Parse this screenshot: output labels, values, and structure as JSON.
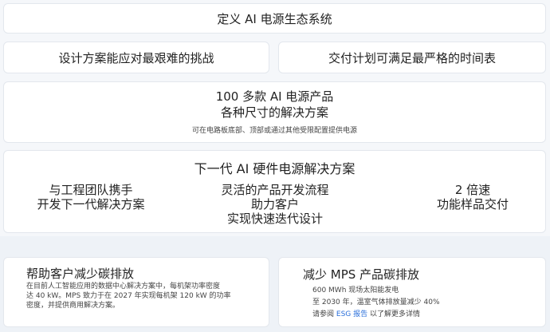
{
  "header": {
    "title": "定义 AI 电源生态系统"
  },
  "row2": {
    "left": "设计方案能应对最艰难的挑战",
    "right": "交付计划可满足最严格的时间表"
  },
  "products": {
    "line1": "100 多款 AI 电源产品",
    "line2": "各种尺寸的解决方案",
    "note": "可在电路板底部、顶部或通过其他受限配置提供电源"
  },
  "nextgen": {
    "title": "下一代 AI 硬件电源解决方案",
    "col1": [
      "与工程团队携手",
      "开发下一代解决方案"
    ],
    "col2": [
      "灵活的产品开发流程",
      "助力客户",
      "实现快速迭代设计"
    ],
    "col3": [
      "2 倍速",
      "功能样品交付"
    ]
  },
  "carbon_customer": {
    "title": "帮助客户减少碳排放",
    "body1": "在目前人工智能应用的数据中心解决方案中，每机架功率密度",
    "body2": "达 40 kW。MPS 致力于在 2027 年实现每机架 120 kW 的功率",
    "body3": "密度，并提供商用解决方案。"
  },
  "carbon_mps": {
    "title": "减少 MPS 产品碳排放",
    "line1": "600 MWh 现场太阳能发电",
    "line2": "至 2030 年，温室气体排放量减少 40%",
    "line3_pre": "请参阅",
    "line3_link": "ESG 报告",
    "line3_post": "以了解更多详情"
  },
  "colors": {
    "link": "#2a6fdb",
    "card_border": "#e3e7ed",
    "background": "#f5f7fa"
  }
}
